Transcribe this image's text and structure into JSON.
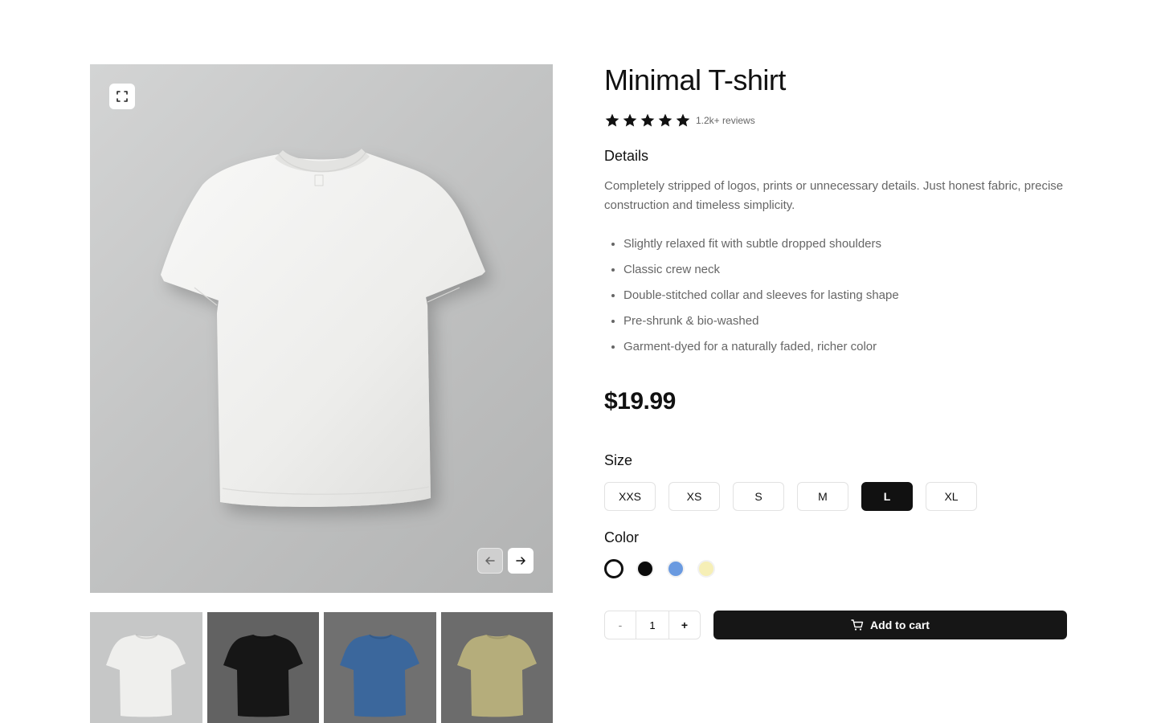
{
  "product": {
    "title": "Minimal T-shirt",
    "rating": 5,
    "reviews_label": "1.2k+ reviews",
    "details_heading": "Details",
    "description": "Completely stripped of logos, prints or unnecessary details. Just honest fabric, precise construction and timeless simplicity.",
    "features": [
      "Slightly relaxed fit with subtle dropped shoulders",
      "Classic crew neck",
      "Double-stitched collar and sleeves for lasting shape",
      "Pre-shrunk & bio-washed",
      "Garment-dyed for a naturally faded, richer color"
    ],
    "price": "$19.99"
  },
  "size": {
    "heading": "Size",
    "options": [
      "XXS",
      "XS",
      "S",
      "M",
      "L",
      "XL"
    ],
    "selected": "L"
  },
  "color": {
    "heading": "Color",
    "options": [
      {
        "name": "white",
        "hex": "#ffffff"
      },
      {
        "name": "black",
        "hex": "#0a0a0a"
      },
      {
        "name": "blue",
        "hex": "#6a9ae0"
      },
      {
        "name": "yellow",
        "hex": "#f6efb6"
      }
    ],
    "selected": "white"
  },
  "cart": {
    "quantity": "1",
    "minus_label": "-",
    "plus_label": "+",
    "add_label": "Add to cart"
  },
  "gallery": {
    "thumbnails": [
      {
        "color": "white",
        "shirt": "#efefed",
        "bg": "#c6c7c7"
      },
      {
        "color": "black",
        "shirt": "#161616",
        "bg": "#626262"
      },
      {
        "color": "blue",
        "shirt": "#3b679c",
        "bg": "#707070"
      },
      {
        "color": "olive",
        "shirt": "#b5ad7b",
        "bg": "#6c6c6c"
      }
    ]
  },
  "icons": {
    "expand": "expand-icon",
    "prev": "arrow-left-icon",
    "next": "arrow-right-icon",
    "cart": "cart-icon",
    "star": "star-icon"
  }
}
